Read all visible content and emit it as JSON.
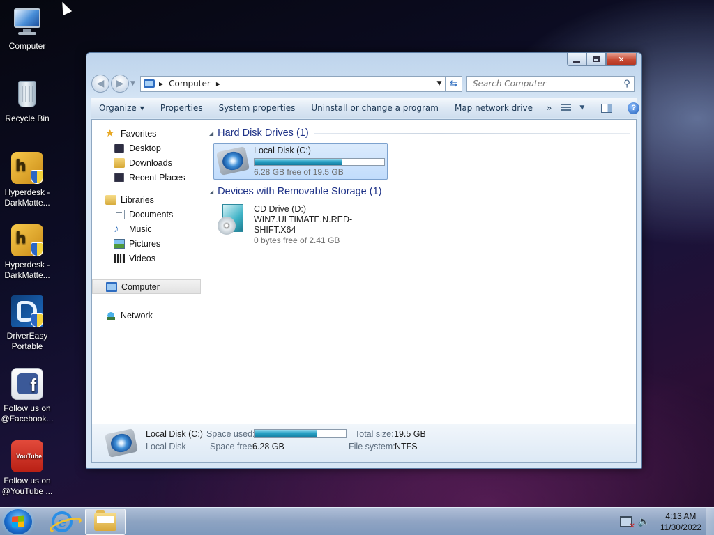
{
  "desktop": {
    "icons": [
      {
        "label": "Computer",
        "icon": "computer-icon"
      },
      {
        "label": "Recycle Bin",
        "icon": "recycle-bin-icon"
      },
      {
        "label": "Hyperdesk -\nDarkMatte...",
        "icon": "hyperdesk-icon"
      },
      {
        "label": "Hyperdesk -\nDarkMatte...",
        "icon": "hyperdesk-icon"
      },
      {
        "label": "DriverEasy\nPortable",
        "icon": "drivereasy-icon"
      },
      {
        "label": "Follow us on\n@Facebook...",
        "icon": "facebook-icon"
      },
      {
        "label": "Follow us on\n@YouTube ...",
        "icon": "youtube-icon"
      }
    ]
  },
  "window": {
    "address": {
      "segment": "Computer"
    },
    "search": {
      "placeholder": "Search Computer"
    },
    "toolbar": {
      "organize": "Organize",
      "properties": "Properties",
      "system_properties": "System properties",
      "uninstall": "Uninstall or change a program",
      "map_drive": "Map network drive",
      "more": "»"
    },
    "nav": {
      "favorites": "Favorites",
      "desktop": "Desktop",
      "downloads": "Downloads",
      "recent": "Recent Places",
      "libraries": "Libraries",
      "documents": "Documents",
      "music": "Music",
      "pictures": "Pictures",
      "videos": "Videos",
      "computer": "Computer",
      "network": "Network"
    },
    "groups": {
      "hdd": {
        "header": "Hard Disk Drives (1)",
        "drive": {
          "name": "Local Disk (C:)",
          "free_text": "6.28 GB free of 19.5 GB",
          "used_fraction": 0.678
        }
      },
      "removable": {
        "header": "Devices with Removable Storage (1)",
        "drive": {
          "name": "CD Drive (D:)",
          "label": "WIN7.ULTIMATE.N.RED-SHIFT.X64",
          "free_text": "0 bytes free of 2.41 GB"
        }
      }
    },
    "details": {
      "name": "Local Disk (C:)",
      "type": "Local Disk",
      "space_used_label": "Space used:",
      "space_used_fraction": 0.678,
      "space_free_label": "Space free:",
      "space_free_value": "6.28 GB",
      "total_size_label": "Total size:",
      "total_size_value": "19.5 GB",
      "file_system_label": "File system:",
      "file_system_value": "NTFS"
    }
  },
  "taskbar": {
    "clock_time": "4:13 AM",
    "clock_date": "11/30/2022"
  },
  "colors": {
    "group_header": "#1e3287",
    "selection": "#c1dcfc",
    "usage_bar": "#2aa2c6"
  }
}
